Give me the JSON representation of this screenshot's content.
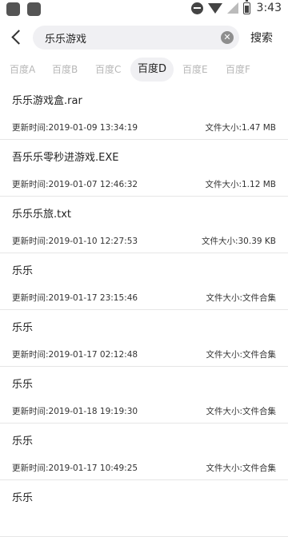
{
  "status_bar": {
    "time": "3:43"
  },
  "search": {
    "back_label": "",
    "query": "乐乐游戏",
    "clear_label": "✕",
    "button_label": "搜索"
  },
  "tabs": [
    {
      "label": "百度A",
      "active": false
    },
    {
      "label": "百度B",
      "active": false
    },
    {
      "label": "百度C",
      "active": false
    },
    {
      "label": "百度D",
      "active": true
    },
    {
      "label": "百度E",
      "active": false
    },
    {
      "label": "百度F",
      "active": false
    }
  ],
  "results": [
    {
      "name": "乐乐游戏盒.rar",
      "time": "更新时间:2019-01-09 13:34:19",
      "size": "文件大小:1.47 MB"
    },
    {
      "name": "吾乐乐零秒进游戏.EXE",
      "time": "更新时间:2019-01-07 12:46:32",
      "size": "文件大小:1.12 MB"
    },
    {
      "name": "乐乐乐旅.txt",
      "time": "更新时间:2019-01-10 12:27:53",
      "size": "文件大小:30.39 KB"
    },
    {
      "name": "乐乐",
      "time": "更新时间:2019-01-17 23:15:46",
      "size": "文件大小:文件合集"
    },
    {
      "name": "乐乐",
      "time": "更新时间:2019-01-17 02:12:48",
      "size": "文件大小:文件合集"
    },
    {
      "name": "乐乐",
      "time": "更新时间:2019-01-18 19:19:30",
      "size": "文件大小:文件合集"
    },
    {
      "name": "乐乐",
      "time": "更新时间:2019-01-17 10:49:25",
      "size": "文件大小:文件合集"
    },
    {
      "name": "乐乐",
      "time": "",
      "size": ""
    }
  ]
}
